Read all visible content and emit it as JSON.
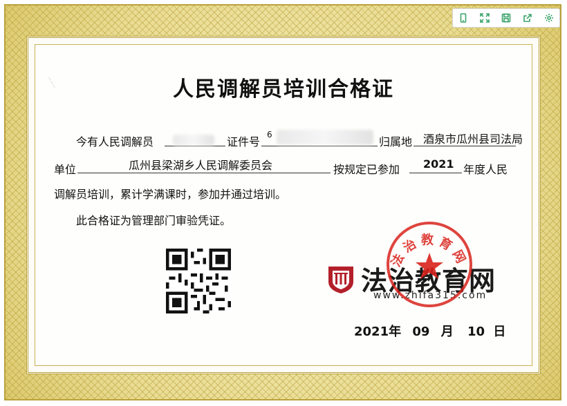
{
  "toolbar": {
    "icons": [
      "mobile-icon",
      "expand-icon",
      "save-icon",
      "share-icon",
      "settings-icon"
    ]
  },
  "certificate": {
    "title": "人民调解员培训合格证",
    "line1": {
      "prefix": "今有人民调解员",
      "id_label": "证件号",
      "id_partial": "6",
      "region_label": "归属地",
      "region_value": "酒泉市瓜州县司法局"
    },
    "line2": {
      "unit_label": "单位",
      "unit_value": "瓜州县梁湖乡人民调解委员会",
      "attend_label": "按规定已参加",
      "year": "2021",
      "suffix": "年度人民"
    },
    "line3": "调解员培训，累计学满课时，参加并通过培训。",
    "line4": "此合格证为管理部门审验凭证。",
    "date": {
      "year": "2021年",
      "month": "09",
      "month_unit": "月",
      "day": "10",
      "day_unit": "日"
    }
  },
  "brand": {
    "name": "法治教育网",
    "url": "www.zhifa315.com",
    "seal_text": "法治教育网"
  },
  "colors": {
    "border_gold": "#b9a13a",
    "seal_red": "#d8231c",
    "logo_red": "#b3202a",
    "toolbar_green": "#3aa36a"
  }
}
